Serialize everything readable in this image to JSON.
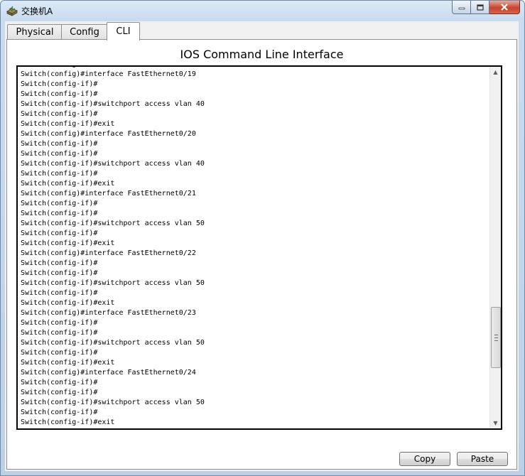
{
  "window": {
    "title": "交换机A",
    "icon": "switch-device-icon"
  },
  "tabs": [
    {
      "label": "Physical",
      "active": false
    },
    {
      "label": "Config",
      "active": false
    },
    {
      "label": "CLI",
      "active": true
    }
  ],
  "panel": {
    "title": "IOS Command Line Interface"
  },
  "terminal": {
    "lines": [
      "Switch(config-if)#exit",
      "Switch(config)#interface FastEthernet0/19",
      "Switch(config-if)#",
      "Switch(config-if)#",
      "Switch(config-if)#switchport access vlan 40",
      "Switch(config-if)#",
      "Switch(config-if)#exit",
      "Switch(config)#interface FastEthernet0/20",
      "Switch(config-if)#",
      "Switch(config-if)#",
      "Switch(config-if)#switchport access vlan 40",
      "Switch(config-if)#",
      "Switch(config-if)#exit",
      "Switch(config)#interface FastEthernet0/21",
      "Switch(config-if)#",
      "Switch(config-if)#",
      "Switch(config-if)#switchport access vlan 50",
      "Switch(config-if)#",
      "Switch(config-if)#exit",
      "Switch(config)#interface FastEthernet0/22",
      "Switch(config-if)#",
      "Switch(config-if)#",
      "Switch(config-if)#switchport access vlan 50",
      "Switch(config-if)#",
      "Switch(config-if)#exit",
      "Switch(config)#interface FastEthernet0/23",
      "Switch(config-if)#",
      "Switch(config-if)#",
      "Switch(config-if)#switchport access vlan 50",
      "Switch(config-if)#",
      "Switch(config-if)#exit",
      "Switch(config)#interface FastEthernet0/24",
      "Switch(config-if)#",
      "Switch(config-if)#",
      "Switch(config-if)#switchport access vlan 50",
      "Switch(config-if)#",
      "Switch(config-if)#exit"
    ]
  },
  "buttons": {
    "copy_label": "Copy",
    "paste_label": "Paste"
  },
  "colors": {
    "terminal_bg": "#ffffff",
    "terminal_text": "#000000",
    "close_button": "#c6452e"
  }
}
